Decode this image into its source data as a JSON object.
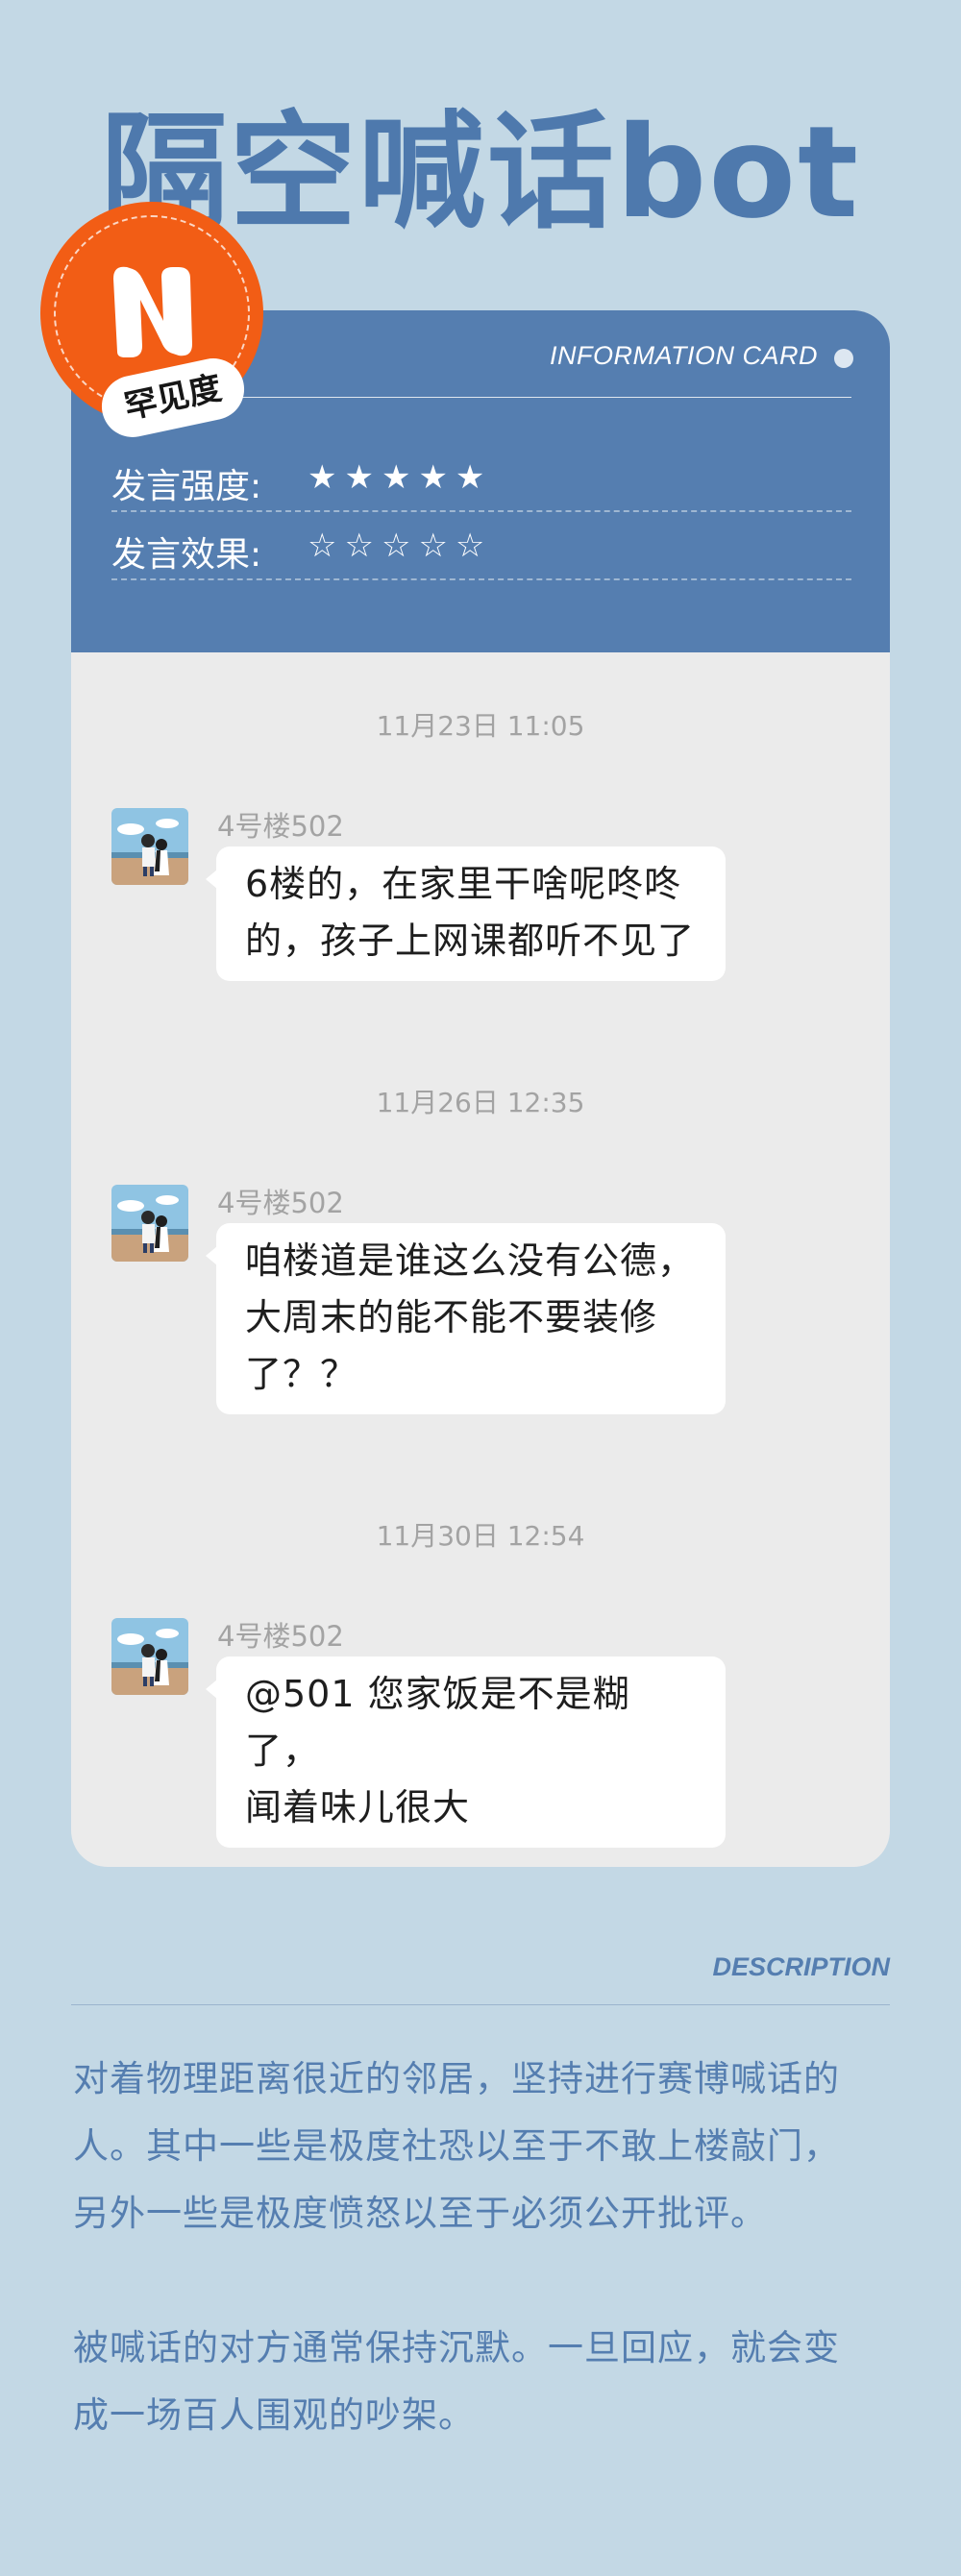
{
  "title": "隔空喊话bot",
  "badge": {
    "letter": "N",
    "tag": "罕见度"
  },
  "card": {
    "label": "INFORMATION CARD",
    "stats": [
      {
        "label": "发言强度:",
        "stars": "★★★★★"
      },
      {
        "label": "发言效果:",
        "stars": "☆☆☆☆☆"
      }
    ]
  },
  "chat": [
    {
      "time": "11月23日 11:05",
      "sender": "4号楼502",
      "lines": [
        "6楼的，在家里干啥呢咚咚",
        "的，孩子上网课都听不见了"
      ]
    },
    {
      "time": "11月26日 12:35",
      "sender": "4号楼502",
      "lines": [
        "咱楼道是谁这么没有公德，",
        "大周末的能不能不要装修",
        "了？？"
      ]
    },
    {
      "time": "11月30日 12:54",
      "sender": "4号楼502",
      "lines": [
        "@501  您家饭是不是糊了，",
        "闻着味儿很大"
      ]
    }
  ],
  "description": {
    "label": "DESCRIPTION",
    "paragraph1": [
      "对着物理距离很近的邻居，坚持进行赛博喊话的",
      "人。其中一些是极度社恐以至于不敢上楼敲门，",
      "另外一些是极度愤怒以至于必须公开批评。"
    ],
    "paragraph2": [
      "被喊话的对方通常保持沉默。一旦回应，就会变",
      "成一场百人围观的吵架。"
    ]
  },
  "colors": {
    "background": "#c3d8e5",
    "accent": "#557eb0",
    "badge": "#f25d15",
    "chat_bg": "#ebebeb"
  }
}
